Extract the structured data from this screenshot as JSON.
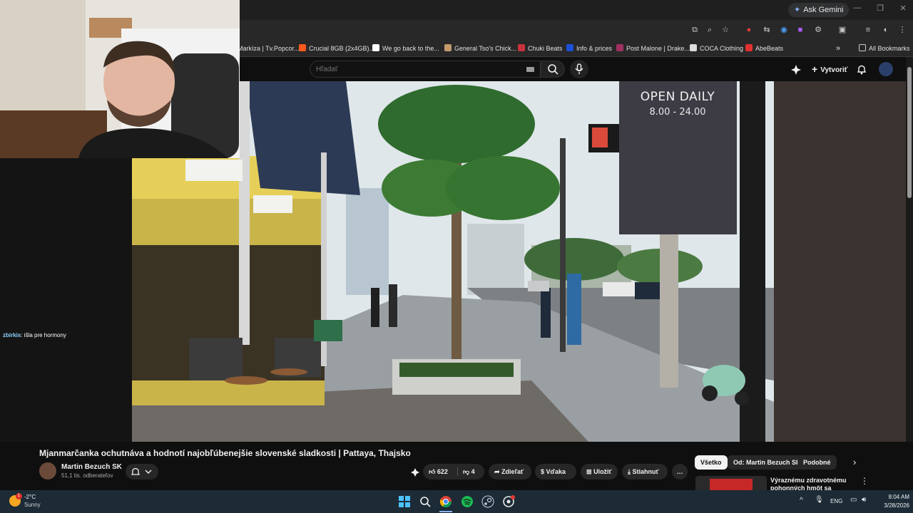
{
  "browser": {
    "ask_gemini": "Ask Gemini",
    "bookmarks": [
      "Markíza | Tv.Popcor...",
      "Crucial 8GB (2x4GB)...",
      "We go back to the...",
      "General Tso's Chick...",
      "Chuki Beats",
      "Info & prices",
      "Post Malone | Drake...",
      "COCA Clothing",
      "AbeBeats"
    ],
    "all_bookmarks": "All Bookmarks",
    "more_bookmarks": "»"
  },
  "youtube": {
    "search_placeholder": "Hľadať",
    "create_label": "Vytvoriť",
    "video_overlay": {
      "sign_title": "OPEN DAILY",
      "sign_hours": "8.00 - 24.00"
    },
    "video_title": "Mjanmarčanka ochutnáva a hodnotí najobľúbenejšie slovenské sladkosti | Pattaya, Thajsko",
    "channel_name": "Martin Bezuch SK",
    "subscribers": "51,1 tis. odberateľov",
    "likes": "622",
    "dislikes": "4",
    "share_label": "Zdieľať",
    "thanks_label": "Vďaka",
    "save_label": "Uložiť",
    "download_label": "Stiahnuť",
    "more_label": "…",
    "chips": [
      "Všetko",
      "Od: Martin Bezuch SK",
      "Podobné"
    ],
    "recommended_title": "Výraznému zdravotnému pohonných hmôt sa nevyhnem"
  },
  "stream_chat": {
    "user": "zbirkis",
    "message": ": išla pre hormony"
  },
  "taskbar": {
    "weather_temp": "-2°C",
    "weather_desc": "Sunny",
    "language": "ENG",
    "time": "8:04 AM",
    "date": "3/28/2026",
    "weather_badge": "1"
  },
  "colors": {
    "youtube_bg": "#0f0f0f",
    "chip_active": "#f1f1f1",
    "taskbar_bg": "#1c2b36"
  }
}
